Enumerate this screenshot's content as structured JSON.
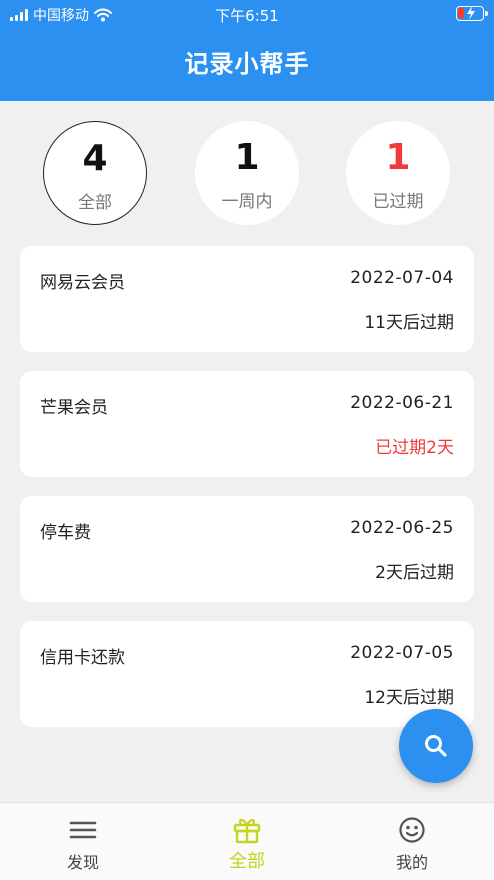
{
  "status_bar": {
    "carrier": "中国移动",
    "time": "下午6:51"
  },
  "header": {
    "title": "记录小帮手"
  },
  "stats": [
    {
      "count": "4",
      "label": "全部",
      "selected": true
    },
    {
      "count": "1",
      "label": "一周内",
      "selected": false
    },
    {
      "count": "1",
      "label": "已过期",
      "selected": false,
      "color": "#f03a3a"
    }
  ],
  "records": [
    {
      "name": "网易云会员",
      "date": "2022-07-04",
      "status": "11天后过期",
      "expired": false
    },
    {
      "name": "芒果会员",
      "date": "2022-06-21",
      "status": "已过期2天",
      "expired": true
    },
    {
      "name": "停车费",
      "date": "2022-06-25",
      "status": "2天后过期",
      "expired": false
    },
    {
      "name": "信用卡还款",
      "date": "2022-07-05",
      "status": "12天后过期",
      "expired": false
    }
  ],
  "fab": {
    "icon": "search-icon"
  },
  "tabbar": {
    "tabs": [
      {
        "label": "发现",
        "icon": "menu-icon",
        "active": false
      },
      {
        "label": "全部",
        "icon": "gift-icon",
        "active": true
      },
      {
        "label": "我的",
        "icon": "smiley-icon",
        "active": false
      }
    ]
  },
  "colors": {
    "primary": "#2b90ef",
    "expired_red": "#f03a3a",
    "active_tab": "#c5d41c",
    "background": "#f0f0f0"
  }
}
